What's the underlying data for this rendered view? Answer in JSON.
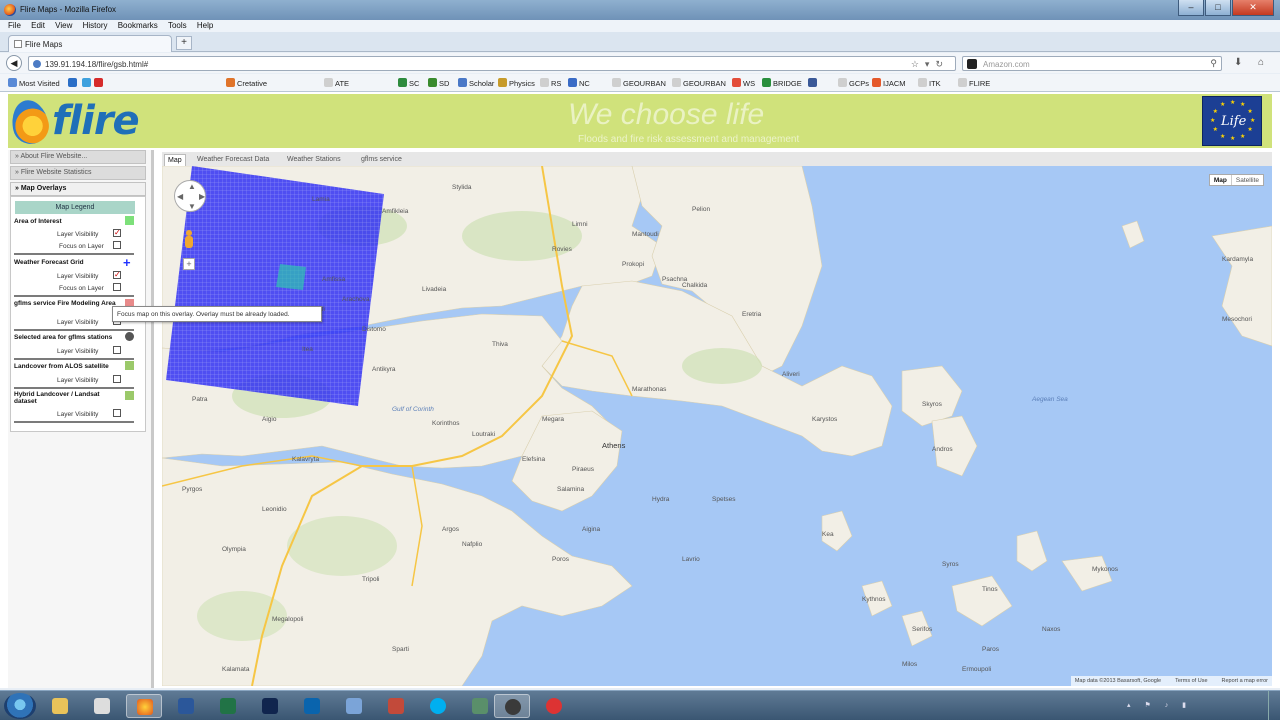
{
  "window": {
    "title": "Flire Maps - Mozilla Firefox",
    "buttons": {
      "minimize": "–",
      "maximize": "□",
      "close": "✕"
    }
  },
  "menu": [
    "File",
    "Edit",
    "View",
    "History",
    "Bookmarks",
    "Tools",
    "Help"
  ],
  "tab": {
    "label": "Flire Maps",
    "new_tab": "+"
  },
  "nav": {
    "url": "139.91.194.18/flire/gsb.html#",
    "search_placeholder": "Amazon.com"
  },
  "bookmarks": [
    {
      "label": "Most Visited",
      "color": "#5a8ad6"
    },
    {
      "label": "",
      "color": "#2b6fc7"
    },
    {
      "label": "",
      "color": "#3ea1de"
    },
    {
      "label": "",
      "color": "#d62b2b"
    },
    {
      "label": "Cretative",
      "color": "#e0742a"
    },
    {
      "label": "ATE",
      "color": "#cfcfcf"
    },
    {
      "label": "SC",
      "color": "#2e8b3e"
    },
    {
      "label": "SD",
      "color": "#3a8b2e"
    },
    {
      "label": "Scholar",
      "color": "#4a78c7"
    },
    {
      "label": "Physics",
      "color": "#c79b2a"
    },
    {
      "label": "RS",
      "color": "#cfcfcf"
    },
    {
      "label": "NC",
      "color": "#3a6bc6"
    },
    {
      "label": "GEOURBAN",
      "color": "#cfcfcf"
    },
    {
      "label": "GEOURBAN",
      "color": "#cfcfcf"
    },
    {
      "label": "WS",
      "color": "#e34d3a"
    },
    {
      "label": "BRIDGE",
      "color": "#2a8f3d"
    },
    {
      "label": "",
      "color": "#3b5998"
    },
    {
      "label": "GCPs",
      "color": "#cfcfcf"
    },
    {
      "label": "IJACM",
      "color": "#e5592b"
    },
    {
      "label": "ITK",
      "color": "#cfcfcf"
    },
    {
      "label": "FLIRE",
      "color": "#cfcfcf"
    }
  ],
  "banner": {
    "logo_text": "flire",
    "slogan": "We choose life",
    "subslogan": "Floods and fire risk assessment and management",
    "eu_logo_text": "Life"
  },
  "sidebar": {
    "sections": [
      "» About Flire Website...",
      "» Flire Website Statistics",
      "» Map Overlays"
    ],
    "legend_title": "Map Legend",
    "layers": [
      {
        "name": "Area of Interest",
        "rows": [
          "Layer Visibility",
          "Focus on Layer"
        ],
        "swatch": "#7de07a"
      },
      {
        "name": "Weather Forecast Grid",
        "rows": [
          "Layer Visibility",
          "Focus on Layer"
        ],
        "swatch": "#2233ff"
      },
      {
        "name": "gflms service Fire Modeling Area",
        "rows": [
          "Layer Visibility"
        ],
        "swatch": "#e88a8a"
      },
      {
        "name": "Selected area for gflms stations",
        "rows": [
          "Layer Visibility"
        ],
        "swatch": "#555"
      },
      {
        "name": "Landcover from ALOS satellite",
        "rows": [
          "Layer Visibility"
        ],
        "swatch": "#9bc96a"
      },
      {
        "name": "Hybrid Landcover / Landsat dataset",
        "rows": [
          "Layer Visibility"
        ],
        "swatch": "#9bc96a"
      }
    ],
    "tooltip": "Focus map on this overlay. Overlay must be already loaded."
  },
  "map_tabs": [
    "Map",
    "Weather Forecast Data",
    "Weather Stations",
    "gflms service"
  ],
  "map": {
    "type_buttons": [
      "Map",
      "Satellite"
    ],
    "attribution": [
      "Map data ©2013 Basarsoft, Google",
      "Terms of Use",
      "Report a map error"
    ],
    "labels": {
      "lamia": "Lamia",
      "stylida": "Stylida",
      "amfikleia": "Amfikleia",
      "limni": "Limni",
      "rovies": "Rovies",
      "prokopi": "Prokopi",
      "mantoudi": "Mantoudi",
      "psachna": "Psachna",
      "pelion": "Pelion",
      "chalkida": "Chalkida",
      "eretria": "Eretria",
      "aliveri": "Aliveri",
      "karystos": "Karystos",
      "thiva": "Thiva",
      "livadeia": "Livadeia",
      "delfi": "Delfi",
      "amfissa": "Amfissa",
      "itea": "Itea",
      "distomo": "Distomo",
      "antikyra": "Antikyra",
      "arachova": "Arachova",
      "corinth": "Korinthos",
      "loutraki": "Loutraki",
      "megara": "Megara",
      "athens": "Athens",
      "piraeus": "Piraeus",
      "salamina": "Salamina",
      "elefsina": "Elefsina",
      "aigina": "Aigina",
      "poros": "Poros",
      "nafplio": "Nafplio",
      "argos": "Argos",
      "tripoli": "Tripoli",
      "megalopoli": "Megalopoli",
      "sparti": "Sparti",
      "kalamata": "Kalamata",
      "patra": "Patra",
      "aigio": "Aigio",
      "kalavryta": "Kalavryta",
      "pyrgos": "Pyrgos",
      "olympia": "Olympia",
      "andros": "Andros",
      "tinos": "Tinos",
      "kea": "Kea",
      "kythnos": "Kythnos",
      "serifos": "Serifos",
      "syros": "Syros",
      "mykonos": "Mykonos",
      "naxos": "Naxos",
      "paros": "Paros",
      "milos": "Milos",
      "skyros": "Skyros",
      "mesochori": "Mesochori",
      "lavrio": "Lavrio",
      "marathon": "Marathonas",
      "aegean": "Aegean Sea",
      "gulf_corinth": "Gulf of Corinth",
      "ermoupoli": "Ermoupoli",
      "kardamyla": "Kardamyla",
      "hydra": "Hydra",
      "spetses": "Spetses",
      "leonidio": "Leonidio"
    }
  }
}
